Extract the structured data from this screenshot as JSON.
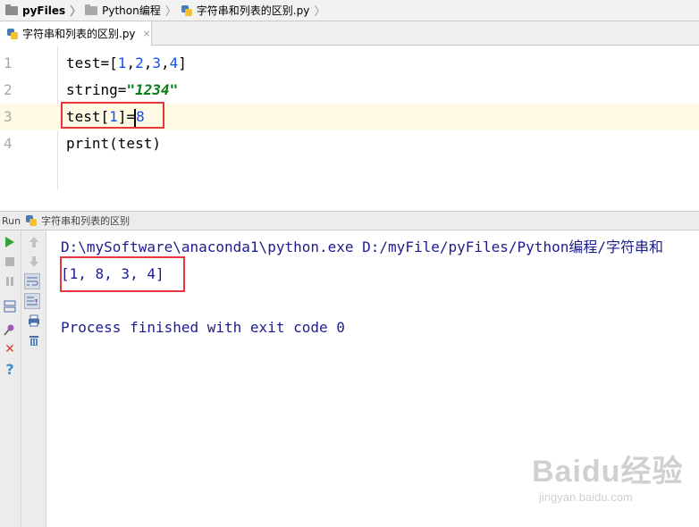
{
  "breadcrumb": {
    "items": [
      {
        "label": "pyFiles",
        "icon": "folder-icon"
      },
      {
        "label": "Python编程",
        "icon": "folder-icon"
      },
      {
        "label": "字符串和列表的区别.py",
        "icon": "python-file-icon"
      }
    ]
  },
  "editor_tab": {
    "label": "字符串和列表的区别.py",
    "close": "×"
  },
  "editor": {
    "lines": [
      {
        "number": "1",
        "tokens": [
          [
            "plain",
            "test=["
          ],
          [
            "num",
            "1"
          ],
          [
            "plain",
            ","
          ],
          [
            "num",
            "2"
          ],
          [
            "plain",
            ","
          ],
          [
            "num",
            "3"
          ],
          [
            "plain",
            ","
          ],
          [
            "num",
            "4"
          ],
          [
            "plain",
            "]"
          ]
        ]
      },
      {
        "number": "2",
        "tokens": [
          [
            "plain",
            "string="
          ],
          [
            "str",
            "\"1234\""
          ]
        ]
      },
      {
        "number": "3",
        "tokens": [
          [
            "plain",
            "test["
          ],
          [
            "num",
            "1"
          ],
          [
            "plain",
            "]="
          ],
          [
            "num",
            "8"
          ]
        ]
      },
      {
        "number": "4",
        "tokens": [
          [
            "plain",
            "print(test)"
          ]
        ]
      }
    ],
    "current_line": 3
  },
  "run_panel": {
    "title": "Run",
    "config_name": "字符串和列表的区别",
    "left_tools": [
      "run-icon",
      "stop-icon",
      "pause-icon",
      "layout-icon",
      "pin-icon",
      "close-icon",
      "help-icon"
    ],
    "mid_tools": [
      "up-arrow-icon",
      "down-arrow-icon",
      "soft-wrap-icon",
      "scroll-to-end-icon",
      "print-icon",
      "trash-icon"
    ],
    "console": [
      "D:\\mySoftware\\anaconda1\\python.exe D:/myFile/pyFiles/Python编程/字符串和",
      "[1, 8, 3, 4]",
      "",
      "Process finished with exit code 0"
    ]
  },
  "watermark": {
    "brand": "Baidu经验",
    "url": "jingyan.baidu.com"
  },
  "colors": {
    "highlight_box": "#e8363f",
    "console_text": "#1c1c8f",
    "number": "#1750eb",
    "string": "#067d17",
    "current_line": "#fffae3"
  }
}
